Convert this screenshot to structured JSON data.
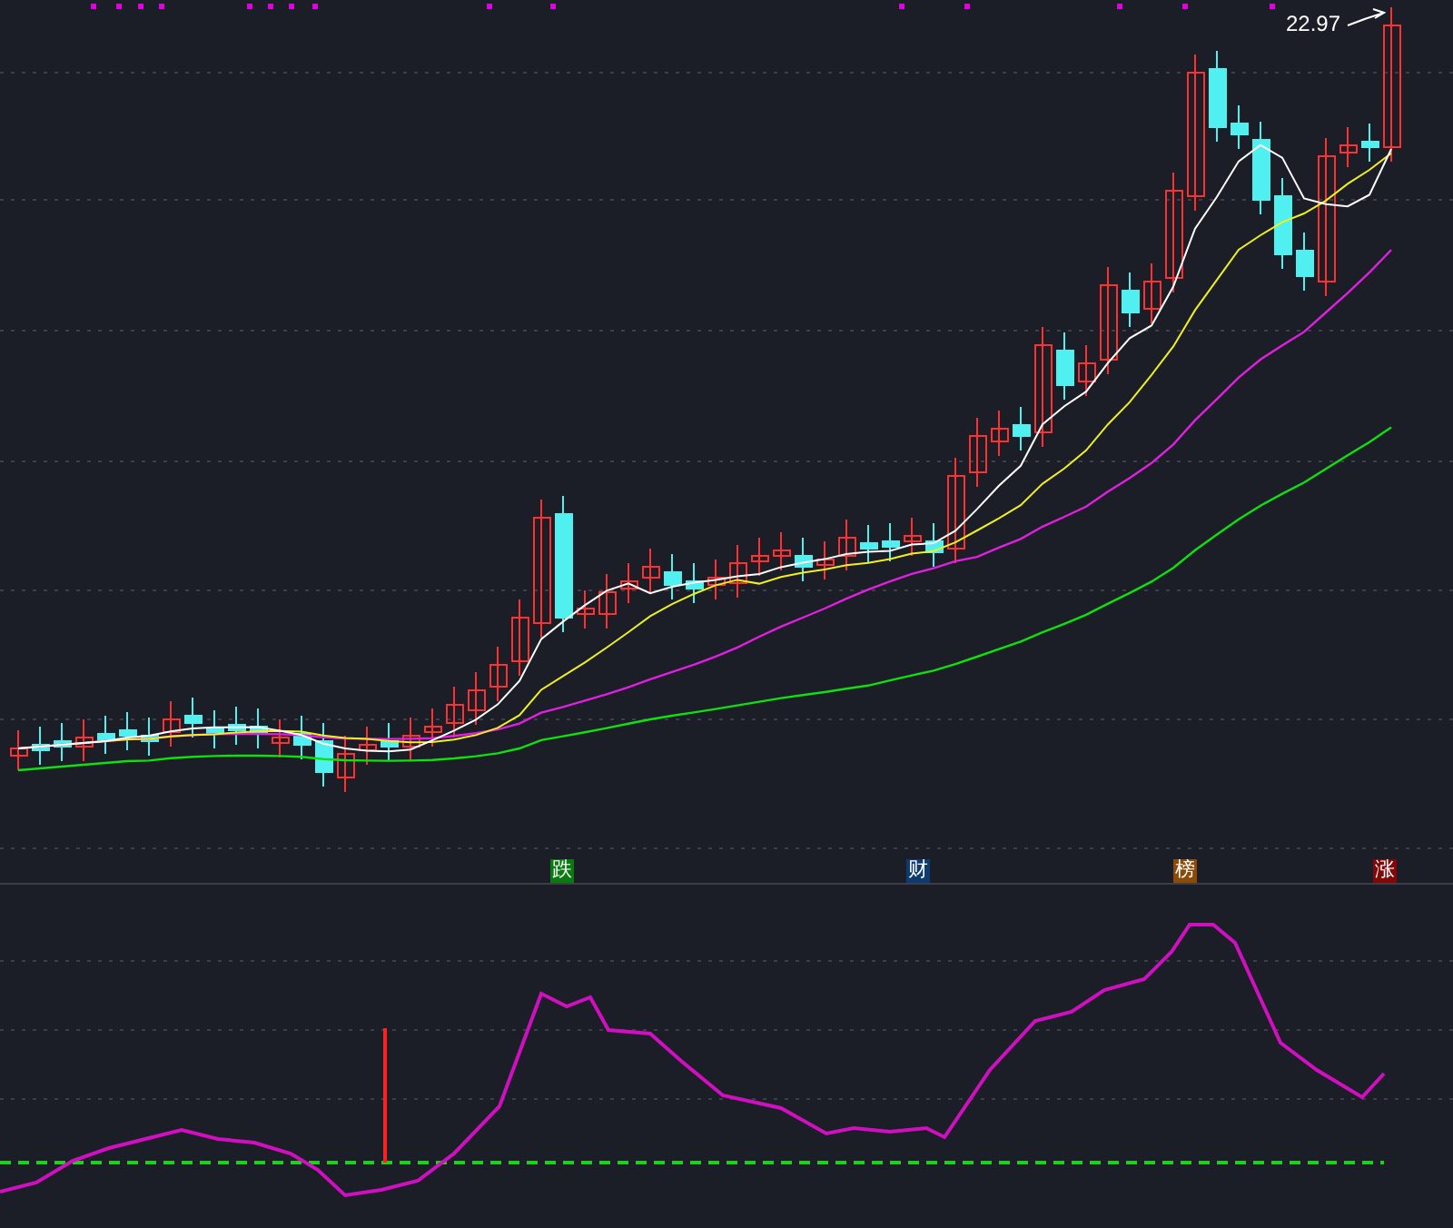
{
  "price_chart": {
    "high_label": "22.97"
  },
  "signal_markers": [
    {
      "text": "跌",
      "color": "#0a7a10"
    },
    {
      "text": "财",
      "color": "#0e3a70"
    },
    {
      "text": "榜",
      "color": "#8a4a08"
    },
    {
      "text": "涨",
      "color": "#800808"
    }
  ]
}
